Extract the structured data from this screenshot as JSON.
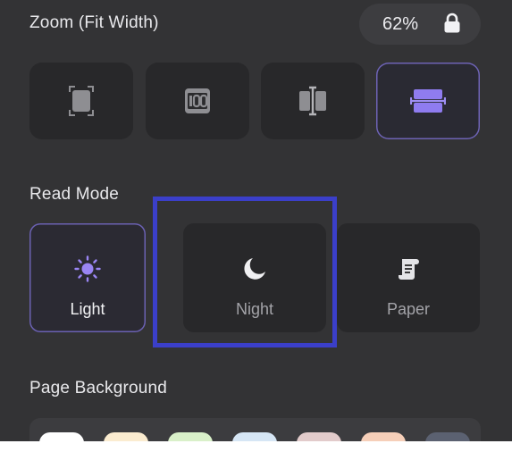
{
  "zoom": {
    "label": "Zoom (Fit Width)",
    "value": "62%",
    "lock_icon": "lock-icon",
    "fit_options": [
      {
        "name": "fit-page",
        "icon": "fit-page-icon",
        "active": false
      },
      {
        "name": "actual-size",
        "icon": "actual-size-100-icon",
        "active": false
      },
      {
        "name": "fit-height",
        "icon": "fit-height-icon",
        "active": false
      },
      {
        "name": "fit-width",
        "icon": "fit-width-icon",
        "active": true
      }
    ]
  },
  "read_mode": {
    "label": "Read Mode",
    "options": [
      {
        "label": "Light",
        "icon": "sun-icon",
        "active": true
      },
      {
        "label": "Night",
        "icon": "moon-icon",
        "active": false
      },
      {
        "label": "Paper",
        "icon": "scroll-icon",
        "active": false
      }
    ],
    "annotation_color": "#3b3fc9"
  },
  "page_background": {
    "label": "Page Background",
    "swatches": [
      "#ffffff",
      "#fbecd0",
      "#d9f0c9",
      "#d6e6f5",
      "#e2cbcb",
      "#f6cfb9",
      "#5b6171"
    ]
  },
  "colors": {
    "panel_bg": "#333335",
    "card_bg": "#28282a",
    "accent": "#8f7cf0",
    "active_border": "#6b61b2"
  }
}
